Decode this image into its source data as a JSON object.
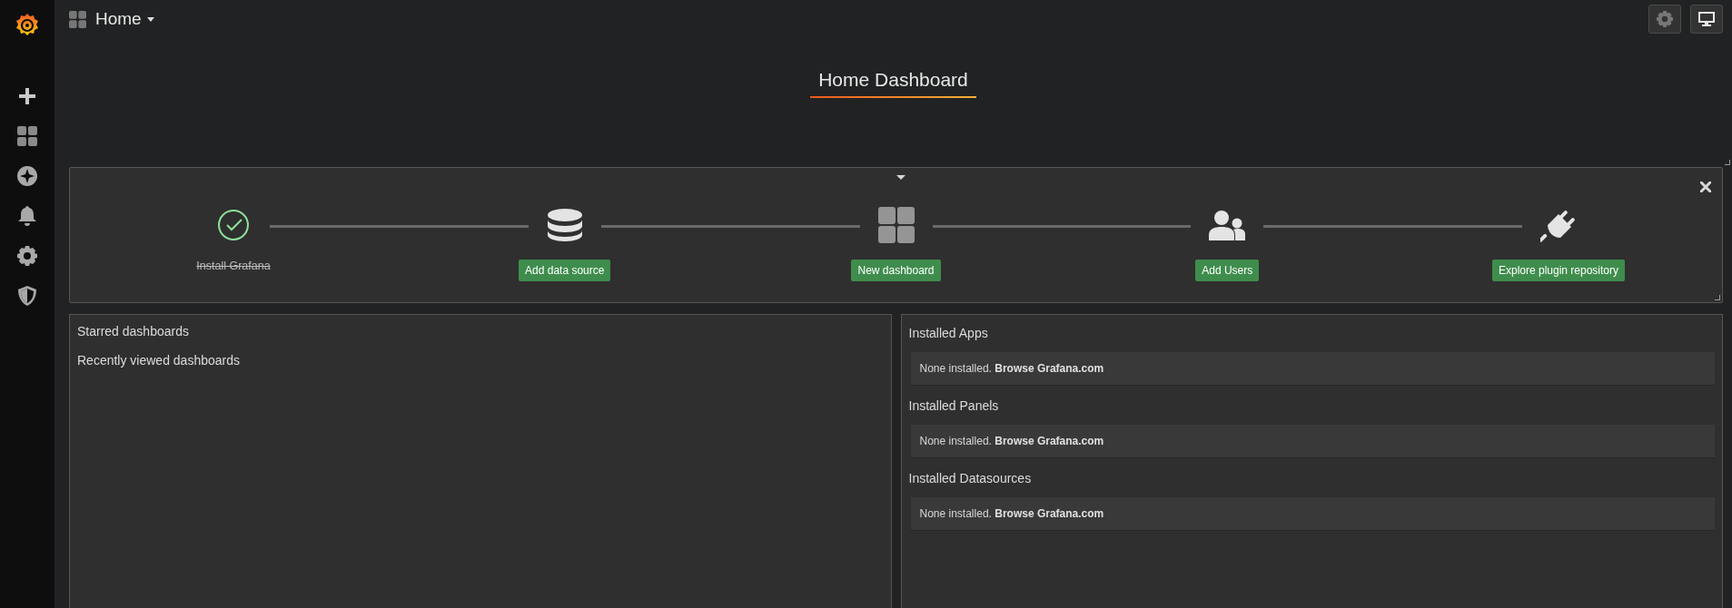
{
  "topbar": {
    "title": "Home"
  },
  "dashboard_title": "Home Dashboard",
  "getting_started": {
    "steps": [
      {
        "kind": "install",
        "label": "Install Grafana",
        "done": true
      },
      {
        "kind": "datasource",
        "label": "Add data source",
        "done": false
      },
      {
        "kind": "dashboard",
        "label": "New dashboard",
        "done": false
      },
      {
        "kind": "users",
        "label": "Add Users",
        "done": false
      },
      {
        "kind": "plugins",
        "label": "Explore plugin repository",
        "done": false
      }
    ]
  },
  "dashboards_panel": {
    "headings": [
      "Starred dashboards",
      "Recently viewed dashboards"
    ]
  },
  "plugins_panel": {
    "sections": [
      {
        "heading": "Installed Apps",
        "text": "None installed.",
        "link": "Browse Grafana.com"
      },
      {
        "heading": "Installed Panels",
        "text": "None installed.",
        "link": "Browse Grafana.com"
      },
      {
        "heading": "Installed Datasources",
        "text": "None installed.",
        "link": "Browse Grafana.com"
      }
    ]
  }
}
